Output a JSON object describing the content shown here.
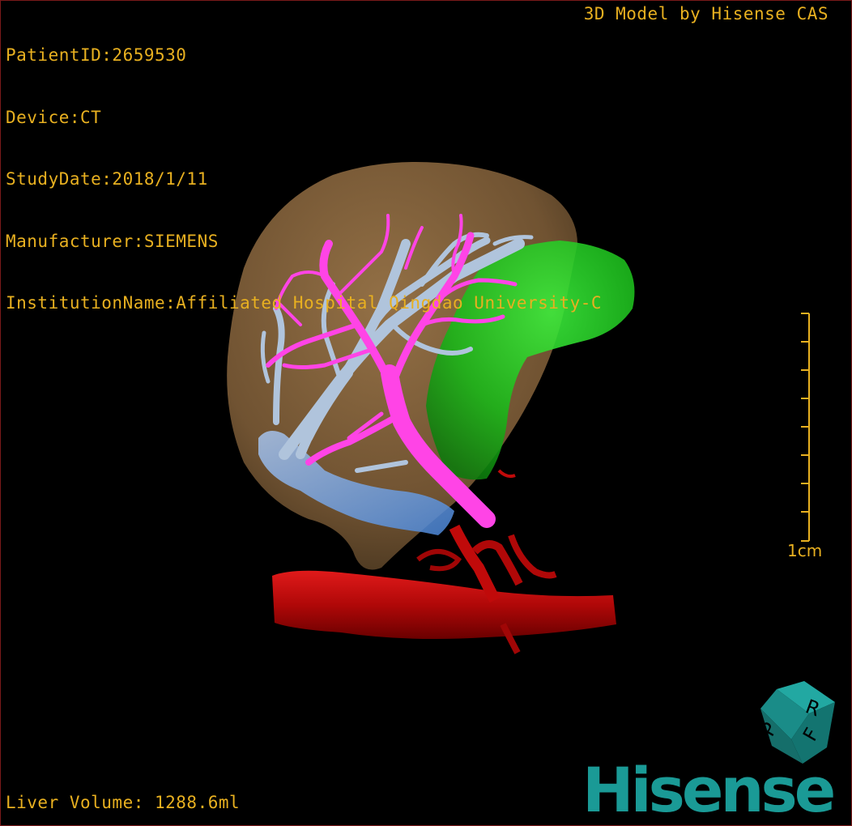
{
  "info": {
    "patient_id": "PatientID:2659530",
    "device": "Device:CT",
    "study_date": "StudyDate:2018/1/11",
    "manufacturer": "Manufacturer:SIEMENS",
    "institution": "InstitutionName:Affiliated Hospital Qingdao University-C"
  },
  "credit": "3D Model by Hisense CAS",
  "scale_bar": {
    "label": "1cm",
    "color": "#e8b020"
  },
  "liver_volume": "Liver Volume: 1288.6ml",
  "orientation_cube": {
    "faces": [
      "R",
      "F",
      "P"
    ],
    "color": "#1a8c88"
  },
  "logo": {
    "text": "Hisense",
    "color": "#1a9a96"
  },
  "colors": {
    "liver": "#8a6640",
    "hepatic_vein": "#b0c4dc",
    "portal_vein": "#ff44e6",
    "tumor": "#1ec81e",
    "ivc": "#5a9ae0",
    "aorta": "#c80a0a",
    "overlay_text": "#e8b020"
  }
}
